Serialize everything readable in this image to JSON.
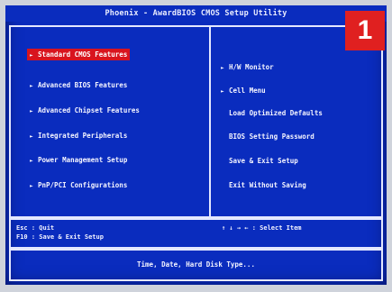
{
  "bios": {
    "title": "Phoenix - AwardBIOS CMOS Setup Utility",
    "left_menu": [
      {
        "label": "Standard CMOS Features",
        "selected": true
      },
      {
        "label": "Advanced BIOS Features",
        "selected": false
      },
      {
        "label": "Advanced Chipset Features",
        "selected": false
      },
      {
        "label": "Integrated Peripherals",
        "selected": false
      },
      {
        "label": "Power Management Setup",
        "selected": false
      },
      {
        "label": "PnP/PCI Configurations",
        "selected": false
      }
    ],
    "right_menu": [
      {
        "label": "H/W Monitor",
        "arrow": true
      },
      {
        "label": "Cell Menu",
        "arrow": true
      },
      {
        "label": "Load Optimized Defaults",
        "arrow": false
      },
      {
        "label": "BIOS Setting Password",
        "arrow": false
      },
      {
        "label": "Save & Exit Setup",
        "arrow": false
      },
      {
        "label": "Exit Without Saving",
        "arrow": false
      }
    ],
    "help": {
      "esc": "Esc : Quit",
      "f10": "F10 : Save & Exit Setup",
      "nav": "↑ ↓ → ←   : Select Item"
    },
    "status": "Time, Date, Hard Disk Type..."
  },
  "badge": {
    "text": "1",
    "color": "#e02020"
  },
  "colors": {
    "background": "#0a2cbe",
    "highlight": "#d8141e",
    "text": "#f4f4ff"
  },
  "icons": {
    "menu_arrow": "triangle-right-icon"
  }
}
